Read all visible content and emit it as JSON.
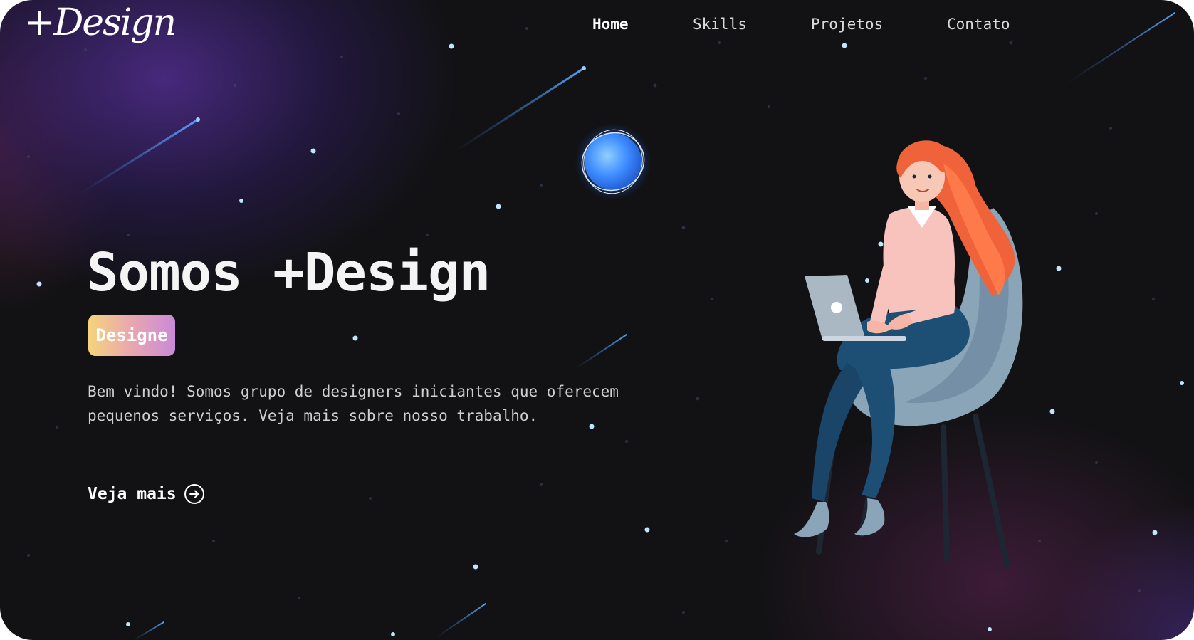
{
  "brand": {
    "logo_text": "+Design"
  },
  "nav": {
    "items": [
      {
        "label": "Home",
        "active": true
      },
      {
        "label": "Skills",
        "active": false
      },
      {
        "label": "Projetos",
        "active": false
      },
      {
        "label": "Contato",
        "active": false
      }
    ]
  },
  "hero": {
    "title": "Somos +Design",
    "badge": "Designe",
    "description": "Bem vindo! Somos grupo de designers iniciantes que oferecem pequenos serviços. Veja mais sobre nosso trabalho.",
    "cta_label": "Veja mais",
    "cta_icon": "arrow-right-circle-icon"
  },
  "colors": {
    "background": "#121214",
    "glow_purple": "#4a2a82",
    "badge_gradient": [
      "#f6d47c",
      "#e9a6b0",
      "#c98ad7"
    ],
    "planet": "#3d8bff",
    "hair": "#f0623a",
    "chair": "#8aa4b8",
    "jeans": "#1d4f75"
  }
}
